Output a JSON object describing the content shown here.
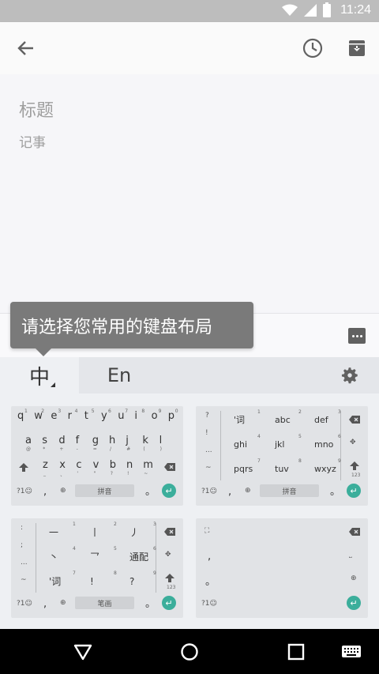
{
  "status_bar": {
    "time": "11:24"
  },
  "app_bar": {},
  "note": {
    "title_placeholder": "标题",
    "body_placeholder": "记事"
  },
  "tooltip": {
    "text": "请选择您常用的键盘布局"
  },
  "keyboard_chooser": {
    "tabs": [
      {
        "label": "中"
      },
      {
        "label": "En"
      }
    ],
    "qwerty": {
      "row1": [
        "q",
        "w",
        "e",
        "r",
        "t",
        "y",
        "u",
        "i",
        "o",
        "p"
      ],
      "row1_hints": [
        "1",
        "2",
        "3",
        "4",
        "5",
        "6",
        "7",
        "8",
        "9",
        "0"
      ],
      "row2": [
        "a",
        "s",
        "d",
        "f",
        "g",
        "h",
        "j",
        "k",
        "l"
      ],
      "row2_hints": [
        "@",
        "*",
        "+",
        "-",
        "=",
        "/",
        "#",
        "(",
        ")"
      ],
      "row3": [
        "z",
        "x",
        "c",
        "v",
        "b",
        "n",
        "m"
      ],
      "row3_hints": [
        "_",
        "、",
        "'",
        "\"",
        "?",
        "!",
        "~"
      ],
      "symbol_key": "?1☺",
      "comma": ",",
      "space_label": "拼音",
      "period": "。"
    },
    "nine_key": {
      "side": [
        "?",
        "!",
        "...",
        "~"
      ],
      "keys": [
        {
          "label": "'词",
          "num": "1"
        },
        {
          "label": "abc",
          "num": "2"
        },
        {
          "label": "def",
          "num": "3"
        },
        {
          "label": "ghi",
          "num": "4"
        },
        {
          "label": "jkl",
          "num": "5"
        },
        {
          "label": "mno",
          "num": "6"
        },
        {
          "label": "pqrs",
          "num": "7"
        },
        {
          "label": "tuv",
          "num": "8"
        },
        {
          "label": "wxyz",
          "num": "9"
        }
      ],
      "shift_hint": "123",
      "symbol_key": "?1☺",
      "comma": ",",
      "space_label": "拼音",
      "period": "。"
    },
    "stroke": {
      "side": [
        ":",
        ";",
        "...",
        "~"
      ],
      "keys": [
        {
          "label": "一",
          "num": "1"
        },
        {
          "label": "丨",
          "num": "2"
        },
        {
          "label": "丿",
          "num": "3"
        },
        {
          "label": "丶",
          "num": "4"
        },
        {
          "label": "乛",
          "num": "5"
        },
        {
          "label": "通配",
          "num": "6"
        },
        {
          "label": "'词",
          "num": "7"
        },
        {
          "label": "!",
          "num": "8"
        },
        {
          "label": "?",
          "num": "9"
        }
      ],
      "shift_hint": "123",
      "symbol_key": "?1☺",
      "comma": ",",
      "space_label": "笔画",
      "period": "。"
    },
    "handwriting": {
      "side": [
        ",",
        "。"
      ],
      "symbol_key": "?1☺"
    }
  },
  "colors": {
    "enter_key": "#3bae9b",
    "tooltip_bg": "#7a7a7a"
  }
}
